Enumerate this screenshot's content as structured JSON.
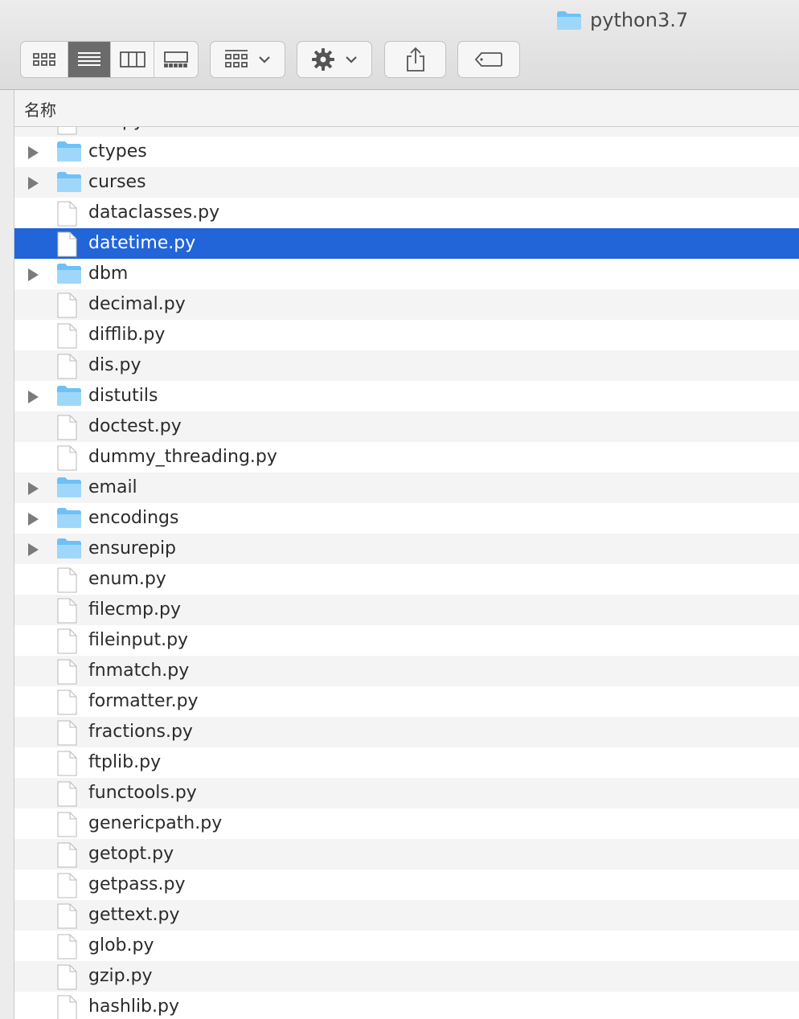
{
  "window": {
    "title": "python3.7"
  },
  "toolbar": {
    "view_buttons": [
      {
        "name": "icon-view-button",
        "icon": "grid-icon",
        "active": false
      },
      {
        "name": "list-view-button",
        "icon": "list-icon",
        "active": true
      },
      {
        "name": "column-view-button",
        "icon": "columns-icon",
        "active": false
      },
      {
        "name": "gallery-view-button",
        "icon": "gallery-icon",
        "active": false
      }
    ],
    "group_button": {
      "icon": "group-grid-icon",
      "menu_icon": "chevron-down-icon"
    },
    "action_button": {
      "icon": "gear-icon",
      "menu_icon": "chevron-down-icon"
    },
    "share_button": {
      "icon": "share-icon"
    },
    "tag_button": {
      "icon": "tag-icon"
    }
  },
  "column_header": {
    "name": "名称"
  },
  "files": [
    {
      "name": "csv.py",
      "type": "file",
      "selected": false
    },
    {
      "name": "ctypes",
      "type": "folder",
      "selected": false
    },
    {
      "name": "curses",
      "type": "folder",
      "selected": false
    },
    {
      "name": "dataclasses.py",
      "type": "file",
      "selected": false
    },
    {
      "name": "datetime.py",
      "type": "file",
      "selected": true
    },
    {
      "name": "dbm",
      "type": "folder",
      "selected": false
    },
    {
      "name": "decimal.py",
      "type": "file",
      "selected": false
    },
    {
      "name": "difflib.py",
      "type": "file",
      "selected": false
    },
    {
      "name": "dis.py",
      "type": "file",
      "selected": false
    },
    {
      "name": "distutils",
      "type": "folder",
      "selected": false
    },
    {
      "name": "doctest.py",
      "type": "file",
      "selected": false
    },
    {
      "name": "dummy_threading.py",
      "type": "file",
      "selected": false
    },
    {
      "name": "email",
      "type": "folder",
      "selected": false
    },
    {
      "name": "encodings",
      "type": "folder",
      "selected": false
    },
    {
      "name": "ensurepip",
      "type": "folder",
      "selected": false
    },
    {
      "name": "enum.py",
      "type": "file",
      "selected": false
    },
    {
      "name": "filecmp.py",
      "type": "file",
      "selected": false
    },
    {
      "name": "fileinput.py",
      "type": "file",
      "selected": false
    },
    {
      "name": "fnmatch.py",
      "type": "file",
      "selected": false
    },
    {
      "name": "formatter.py",
      "type": "file",
      "selected": false
    },
    {
      "name": "fractions.py",
      "type": "file",
      "selected": false
    },
    {
      "name": "ftplib.py",
      "type": "file",
      "selected": false
    },
    {
      "name": "functools.py",
      "type": "file",
      "selected": false
    },
    {
      "name": "genericpath.py",
      "type": "file",
      "selected": false
    },
    {
      "name": "getopt.py",
      "type": "file",
      "selected": false
    },
    {
      "name": "getpass.py",
      "type": "file",
      "selected": false
    },
    {
      "name": "gettext.py",
      "type": "file",
      "selected": false
    },
    {
      "name": "glob.py",
      "type": "file",
      "selected": false
    },
    {
      "name": "gzip.py",
      "type": "file",
      "selected": false
    },
    {
      "name": "hashlib.py",
      "type": "file",
      "selected": false
    }
  ],
  "colors": {
    "selection": "#2265d8",
    "folder": "#6ec1f5",
    "stripe": "#f4f4f5"
  }
}
